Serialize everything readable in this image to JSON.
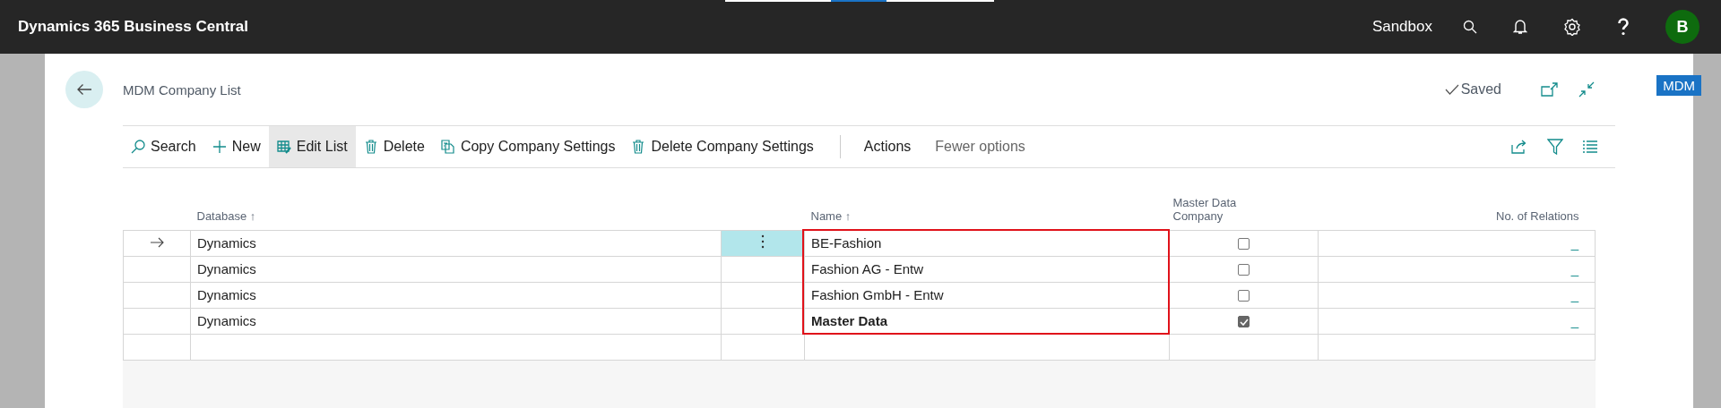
{
  "app_bar": {
    "title": "Dynamics 365 Business Central",
    "environment": "Sandbox",
    "avatar": "B"
  },
  "side_badge": "MDM",
  "page": {
    "title": "MDM Company List",
    "save_state": "Saved"
  },
  "actions": [
    {
      "label": "Search",
      "selected": false
    },
    {
      "label": "New",
      "selected": false
    },
    {
      "label": "Edit List",
      "selected": true
    },
    {
      "label": "Delete",
      "selected": false
    },
    {
      "label": "Copy Company Settings",
      "selected": false
    },
    {
      "label": "Delete Company Settings",
      "selected": false
    }
  ],
  "menus": [
    {
      "label": "Actions",
      "kind": "menu"
    },
    {
      "label": "Fewer options",
      "kind": "toggle"
    }
  ],
  "table": {
    "columns": [
      "Database ↑",
      "Name ↑",
      "Master Data Company",
      "No. of Relations"
    ],
    "rows": [
      {
        "database": "Dynamics",
        "name": "BE-Fashion",
        "master": false,
        "relations": "_",
        "selected": true,
        "bold": false
      },
      {
        "database": "Dynamics",
        "name": "Fashion AG - Entw",
        "master": false,
        "relations": "_",
        "selected": false,
        "bold": false
      },
      {
        "database": "Dynamics",
        "name": "Fashion GmbH - Entw",
        "master": false,
        "relations": "_",
        "selected": false,
        "bold": false
      },
      {
        "database": "Dynamics",
        "name": "Master Data",
        "master": true,
        "relations": "_",
        "selected": false,
        "bold": true
      }
    ]
  }
}
